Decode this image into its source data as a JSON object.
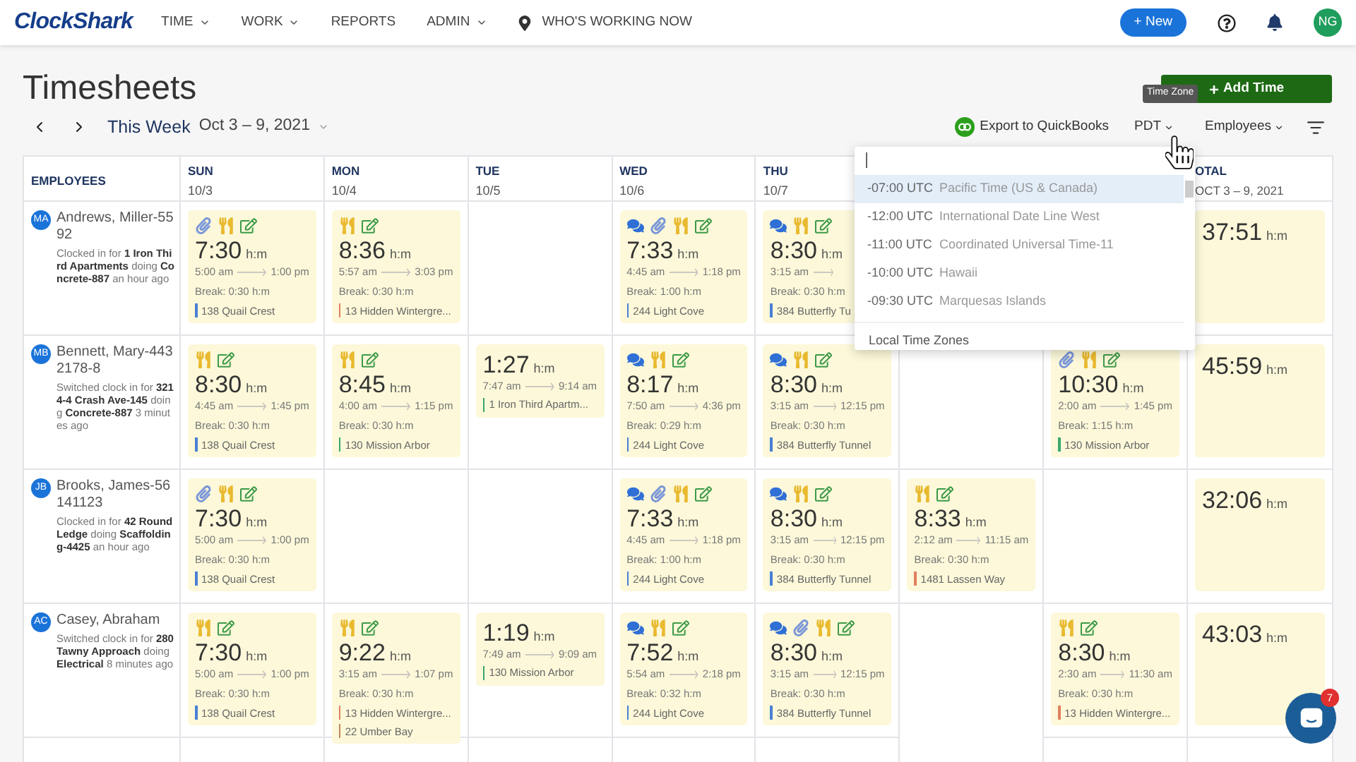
{
  "nav": {
    "logo": "ClockShark",
    "items": [
      {
        "label": "TIME",
        "kind": "dropdown"
      },
      {
        "label": "WORK",
        "kind": "dropdown"
      },
      {
        "label": "REPORTS",
        "kind": "link"
      },
      {
        "label": "ADMIN",
        "kind": "dropdown"
      },
      {
        "label": "WHO'S WORKING NOW",
        "kind": "location"
      }
    ],
    "new_button": "+ New",
    "avatar": "NG"
  },
  "page": {
    "title": "Timesheets",
    "add_button": "Add Time"
  },
  "toolbar": {
    "period": "This Week",
    "range": "Oct 3 – 9, 2021",
    "export": "Export to QuickBooks",
    "timezone": "PDT",
    "filter": "Employees",
    "tooltip": "Time Zone"
  },
  "table": {
    "employees_header": "EMPLOYEES",
    "days": [
      {
        "day": "SUN",
        "date": "10/3"
      },
      {
        "day": "MON",
        "date": "10/4"
      },
      {
        "day": "TUE",
        "date": "10/5"
      },
      {
        "day": "WED",
        "date": "10/6"
      },
      {
        "day": "THU",
        "date": "10/7"
      }
    ],
    "total_header": {
      "title": "OTAL",
      "range": "OCT 3 – 9, 2021"
    },
    "rows": [
      {
        "initials": "MA",
        "name": "Andrews, Miller-5592",
        "status": "Clocked in for **1 Iron Third Apartments** doing **Concrete-887** an hour ago",
        "total": "37:51",
        "total_unit": "h:m",
        "days": {
          "sun": {
            "icons": [
              {
                "kind": "attach"
              },
              {
                "kind": "meal"
              },
              {
                "kind": "edit"
              }
            ],
            "hours": "7:30",
            "unit": "h:m",
            "start": "5:00 am",
            "end": "1:00 pm",
            "break": "Break: 0:30 h:m",
            "locations": [
              {
                "text": "138 Quail Crest",
                "color": "#4a7fd4"
              }
            ]
          },
          "mon": {
            "icons": [
              {
                "kind": "meal"
              },
              {
                "kind": "edit"
              }
            ],
            "hours": "8:36",
            "unit": "h:m",
            "start": "5:57 am",
            "end": "3:03 pm",
            "break": "Break: 0:30 h:m",
            "locations": [
              {
                "text": "13 Hidden Wintergre...",
                "color": "#e0805e"
              }
            ]
          },
          "wed": {
            "icons": [
              {
                "kind": "chat"
              },
              {
                "kind": "attach"
              },
              {
                "kind": "meal"
              },
              {
                "kind": "edit"
              }
            ],
            "hours": "7:33",
            "unit": "h:m",
            "start": "4:45 am",
            "end": "1:18 pm",
            "break": "Break: 1:00 h:m",
            "locations": [
              {
                "text": "244 Light Cove",
                "color": "#4a7fd4"
              }
            ]
          },
          "thu": {
            "icons": [
              {
                "kind": "chat"
              },
              {
                "kind": "meal"
              },
              {
                "kind": "edit"
              }
            ],
            "hours": "8:30",
            "unit": "h:m",
            "start": "3:15 am",
            "break": "Break: 0:30 h:m",
            "locations": [
              {
                "text": "384 Butterfly Tu",
                "color": "#4a7fd4"
              }
            ]
          }
        }
      },
      {
        "initials": "MB",
        "name": "Bennett, Mary-4432178-8",
        "status": "Switched clock in for **3214-4 Crash Ave-145** doing **Concrete-887** 3 minutes ago",
        "total": "45:59",
        "total_unit": "h:m",
        "days": {
          "sun": {
            "icons": [
              {
                "kind": "meal"
              },
              {
                "kind": "edit"
              }
            ],
            "hours": "8:30",
            "unit": "h:m",
            "start": "4:45 am",
            "end": "1:45 pm",
            "break": "Break: 0:30 h:m",
            "locations": [
              {
                "text": "138 Quail Crest",
                "color": "#4a7fd4"
              }
            ]
          },
          "mon": {
            "icons": [
              {
                "kind": "meal"
              },
              {
                "kind": "edit"
              }
            ],
            "hours": "8:45",
            "unit": "h:m",
            "start": "4:00 am",
            "end": "1:15 pm",
            "break": "Break: 0:30 h:m",
            "locations": [
              {
                "text": "130 Mission Arbor",
                "color": "#3aa76d"
              }
            ]
          },
          "tue": {
            "hours": "1:27",
            "unit": "h:m",
            "start": "7:47 am",
            "end": "9:14 am",
            "locations": [
              {
                "text": "1 Iron Third Apartm...",
                "color": "#3aa76d"
              }
            ]
          },
          "wed": {
            "icons": [
              {
                "kind": "chat"
              },
              {
                "kind": "meal"
              },
              {
                "kind": "edit"
              }
            ],
            "hours": "8:17",
            "unit": "h:m",
            "start": "7:50 am",
            "end": "4:36 pm",
            "break": "Break: 0:29 h:m",
            "locations": [
              {
                "text": "244 Light Cove",
                "color": "#4a7fd4"
              }
            ]
          },
          "thu": {
            "icons": [
              {
                "kind": "chat"
              },
              {
                "kind": "meal"
              },
              {
                "kind": "edit"
              }
            ],
            "hours": "8:30",
            "unit": "h:m",
            "start": "3:15 am",
            "end": "12:15 pm",
            "break": "Break: 0:30 h:m",
            "locations": [
              {
                "text": "384 Butterfly Tunnel",
                "color": "#4a7fd4"
              }
            ]
          },
          "sat": {
            "icons": [
              {
                "kind": "attach"
              },
              {
                "kind": "meal"
              },
              {
                "kind": "edit"
              }
            ],
            "hours": "10:30",
            "unit": "h:m",
            "start": "2:00 am",
            "end": "1:45 pm",
            "break": "Break: 1:15 h:m",
            "locations": [
              {
                "text": "130 Mission Arbor",
                "color": "#3aa76d"
              }
            ]
          }
        }
      },
      {
        "initials": "JB",
        "name": "Brooks, James-56141123",
        "status": "Clocked in for **42 Round Ledge** doing **Scaffolding-4425** an hour ago",
        "total": "32:06",
        "total_unit": "h:m",
        "days": {
          "sun": {
            "icons": [
              {
                "kind": "attach"
              },
              {
                "kind": "meal"
              },
              {
                "kind": "edit"
              }
            ],
            "hours": "7:30",
            "unit": "h:m",
            "start": "5:00 am",
            "end": "1:00 pm",
            "break": "Break: 0:30 h:m",
            "locations": [
              {
                "text": "138 Quail Crest",
                "color": "#4a7fd4"
              }
            ]
          },
          "wed": {
            "icons": [
              {
                "kind": "chat"
              },
              {
                "kind": "attach"
              },
              {
                "kind": "meal"
              },
              {
                "kind": "edit"
              }
            ],
            "hours": "7:33",
            "unit": "h:m",
            "start": "4:45 am",
            "end": "1:18 pm",
            "break": "Break: 1:00 h:m",
            "locations": [
              {
                "text": "244 Light Cove",
                "color": "#4a7fd4"
              }
            ]
          },
          "thu": {
            "icons": [
              {
                "kind": "chat"
              },
              {
                "kind": "meal"
              },
              {
                "kind": "edit"
              }
            ],
            "hours": "8:30",
            "unit": "h:m",
            "start": "3:15 am",
            "end": "12:15 pm",
            "break": "Break: 0:30 h:m",
            "locations": [
              {
                "text": "384 Butterfly Tunnel",
                "color": "#4a7fd4"
              }
            ]
          },
          "fri": {
            "icons": [
              {
                "kind": "meal"
              },
              {
                "kind": "edit"
              }
            ],
            "hours": "8:33",
            "unit": "h:m",
            "start": "2:12 am",
            "end": "11:15 am",
            "break": "Break: 0:30 h:m",
            "locations": [
              {
                "text": "1481 Lassen Way",
                "color": "#e0805e"
              }
            ]
          }
        }
      },
      {
        "initials": "AC",
        "name": "Casey, Abraham",
        "status": "Switched clock in for **280 Tawny Approach** doing **Electrical** 8 minutes ago",
        "total": "43:03",
        "total_unit": "h:m",
        "days": {
          "sun": {
            "icons": [
              {
                "kind": "meal"
              },
              {
                "kind": "edit"
              }
            ],
            "hours": "7:30",
            "unit": "h:m",
            "start": "5:00 am",
            "end": "1:00 pm",
            "break": "Break: 0:30 h:m",
            "locations": [
              {
                "text": "138 Quail Crest",
                "color": "#4a7fd4"
              }
            ]
          },
          "mon": {
            "icons": [
              {
                "kind": "meal"
              },
              {
                "kind": "edit"
              }
            ],
            "hours": "9:22",
            "unit": "h:m",
            "start": "3:15 am",
            "end": "1:07 pm",
            "break": "Break: 0:30 h:m",
            "locations": [
              {
                "text": "13 Hidden Wintergre...",
                "color": "#e0805e"
              },
              {
                "text": "22 Umber Bay",
                "color": "#c08a5c"
              }
            ]
          },
          "tue": {
            "hours": "1:19",
            "unit": "h:m",
            "start": "7:49 am",
            "end": "9:09 am",
            "locations": [
              {
                "text": "130 Mission Arbor",
                "color": "#3aa76d"
              }
            ]
          },
          "wed": {
            "icons": [
              {
                "kind": "chat"
              },
              {
                "kind": "meal"
              },
              {
                "kind": "edit"
              }
            ],
            "hours": "7:52",
            "unit": "h:m",
            "start": "5:54 am",
            "end": "2:18 pm",
            "break": "Break: 0:32 h:m",
            "locations": [
              {
                "text": "244 Light Cove",
                "color": "#4a7fd4"
              }
            ]
          },
          "thu": {
            "icons": [
              {
                "kind": "chat"
              },
              {
                "kind": "attach"
              },
              {
                "kind": "meal"
              },
              {
                "kind": "edit"
              }
            ],
            "hours": "8:30",
            "unit": "h:m",
            "start": "3:15 am",
            "end": "12:15 pm",
            "break": "Break: 0:30 h:m",
            "locations": [
              {
                "text": "384 Butterfly Tunnel",
                "color": "#4a7fd4"
              }
            ]
          },
          "sat": {
            "icons": [
              {
                "kind": "meal"
              },
              {
                "kind": "edit"
              }
            ],
            "hours": "8:30",
            "unit": "h:m",
            "start": "2:30 am",
            "end": "11:30 am",
            "break": "Break: 0:30 h:m",
            "locations": [
              {
                "text": "13 Hidden Wintergre...",
                "color": "#e0805e"
              }
            ]
          }
        }
      }
    ]
  },
  "timezone_menu": {
    "options": [
      {
        "offset": "-07:00 UTC",
        "name": "Pacific Time (US & Canada)",
        "selected": true
      },
      {
        "offset": "-12:00 UTC",
        "name": "International Date Line West",
        "selected": false
      },
      {
        "offset": "-11:00 UTC",
        "name": "Coordinated Universal Time-11",
        "selected": false
      },
      {
        "offset": "-10:00 UTC",
        "name": "Hawaii",
        "selected": false
      },
      {
        "offset": "-09:30 UTC",
        "name": "Marquesas Islands",
        "selected": false
      }
    ],
    "section": "Local Time Zones"
  },
  "chat": {
    "badge": "7"
  }
}
